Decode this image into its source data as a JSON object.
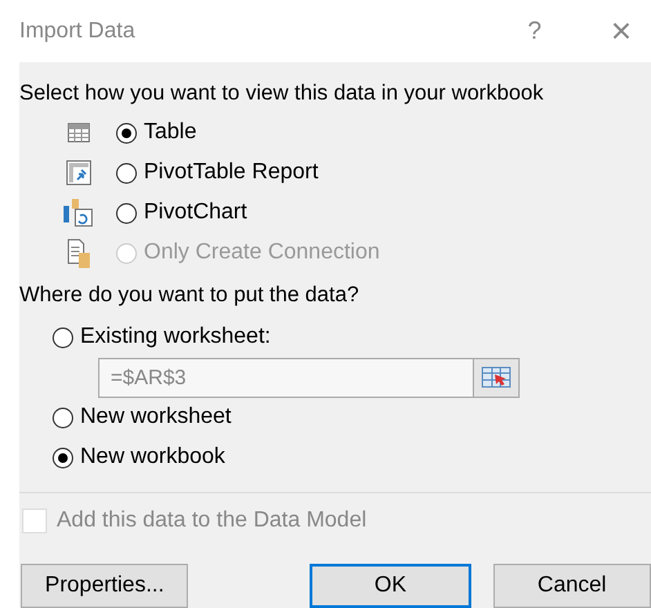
{
  "window": {
    "title": "Import Data",
    "help": "?",
    "close": "×"
  },
  "view_section": {
    "heading": "Select how you want to view this data in your workbook",
    "options": [
      {
        "label": "Table",
        "selected": true,
        "disabled": false
      },
      {
        "label": "PivotTable Report",
        "selected": false,
        "disabled": false
      },
      {
        "label": "PivotChart",
        "selected": false,
        "disabled": false
      },
      {
        "label": "Only Create Connection",
        "selected": false,
        "disabled": true
      }
    ]
  },
  "location_section": {
    "heading": "Where do you want to put the data?",
    "options": [
      {
        "label": "Existing worksheet:",
        "selected": false
      },
      {
        "label": "New worksheet",
        "selected": false
      },
      {
        "label": "New workbook",
        "selected": true
      }
    ],
    "range_field": {
      "value": "=$AR$3",
      "disabled": true
    }
  },
  "data_model": {
    "label": "Add this data to the Data Model",
    "checked": false,
    "disabled": true
  },
  "buttons": [
    {
      "label": "Properties...",
      "default": false
    },
    {
      "label": "OK",
      "default": true
    },
    {
      "label": "Cancel",
      "default": false
    }
  ]
}
